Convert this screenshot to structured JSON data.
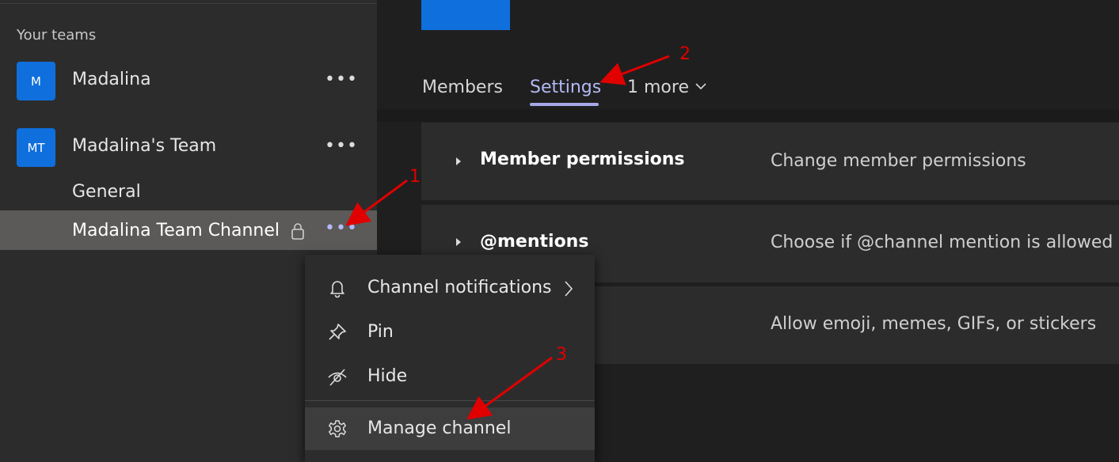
{
  "sidebar": {
    "section_title": "Your teams",
    "teams": [
      {
        "initials": "M",
        "name": "Madalina",
        "more": "•••"
      },
      {
        "initials": "MT",
        "name": "Madalina's Team",
        "more": "•••"
      }
    ],
    "channels": [
      {
        "name": "General"
      },
      {
        "name": "Madalina Team Channel",
        "more": "•••",
        "private_icon": "lock-icon"
      }
    ]
  },
  "tabs": {
    "members": "Members",
    "settings": "Settings",
    "more": "1 more"
  },
  "settings_rows": [
    {
      "title": "Member permissions",
      "description": "Change member permissions"
    },
    {
      "title": "@mentions",
      "description": "Choose if @channel mention is allowed"
    },
    {
      "title": "",
      "description": "Allow emoji, memes, GIFs, or stickers"
    }
  ],
  "context_menu": {
    "items": [
      {
        "label": "Channel notifications",
        "icon": "bell-icon",
        "has_submenu": true
      },
      {
        "label": "Pin",
        "icon": "pin-icon"
      },
      {
        "label": "Hide",
        "icon": "hide-icon"
      },
      {
        "label": "Manage channel",
        "icon": "gear-icon"
      }
    ]
  },
  "annotations": {
    "step_1": "1",
    "step_2": "2",
    "step_3": "3",
    "color": "#e00000"
  },
  "colors": {
    "accent": "#b4b9f5",
    "team_avatar": "#0f6fdc",
    "sidebar_bg": "#2d2c2c",
    "app_bg": "#1f1f1f"
  }
}
